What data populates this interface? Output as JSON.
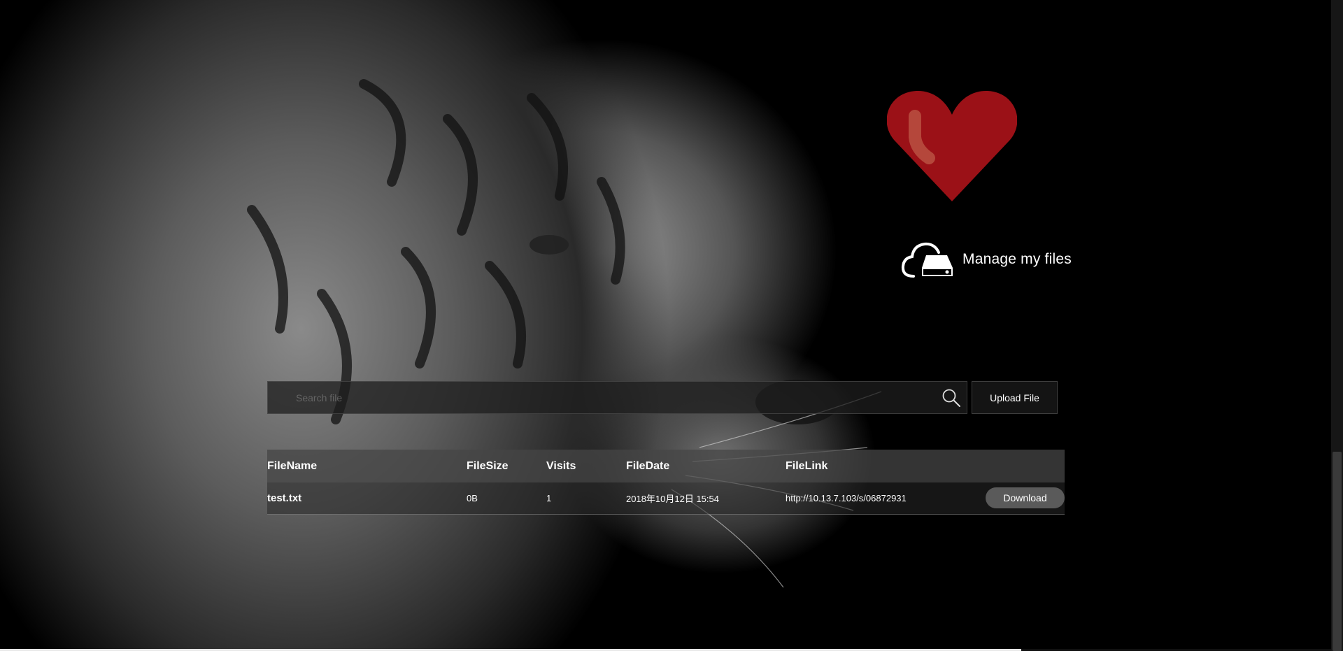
{
  "manage": {
    "label": "Manage my files"
  },
  "search": {
    "placeholder": "Search file",
    "value": ""
  },
  "upload": {
    "label": "Upload File"
  },
  "table": {
    "headers": [
      "FileName",
      "FileSize",
      "Visits",
      "FileDate",
      "FileLink"
    ],
    "rows": [
      {
        "name": "test.txt",
        "size": "0B",
        "visits": "1",
        "date": "2018年10月12日 15:54",
        "link": "http://10.13.7.103/s/06872931",
        "action": "Download"
      }
    ]
  },
  "colors": {
    "heart": "#9b1117",
    "heart_highlight": "#b5473b",
    "background": "#000000"
  },
  "icons": {
    "logo": "heart-icon",
    "manage": "cloud-drive-icon",
    "search": "search-icon"
  }
}
